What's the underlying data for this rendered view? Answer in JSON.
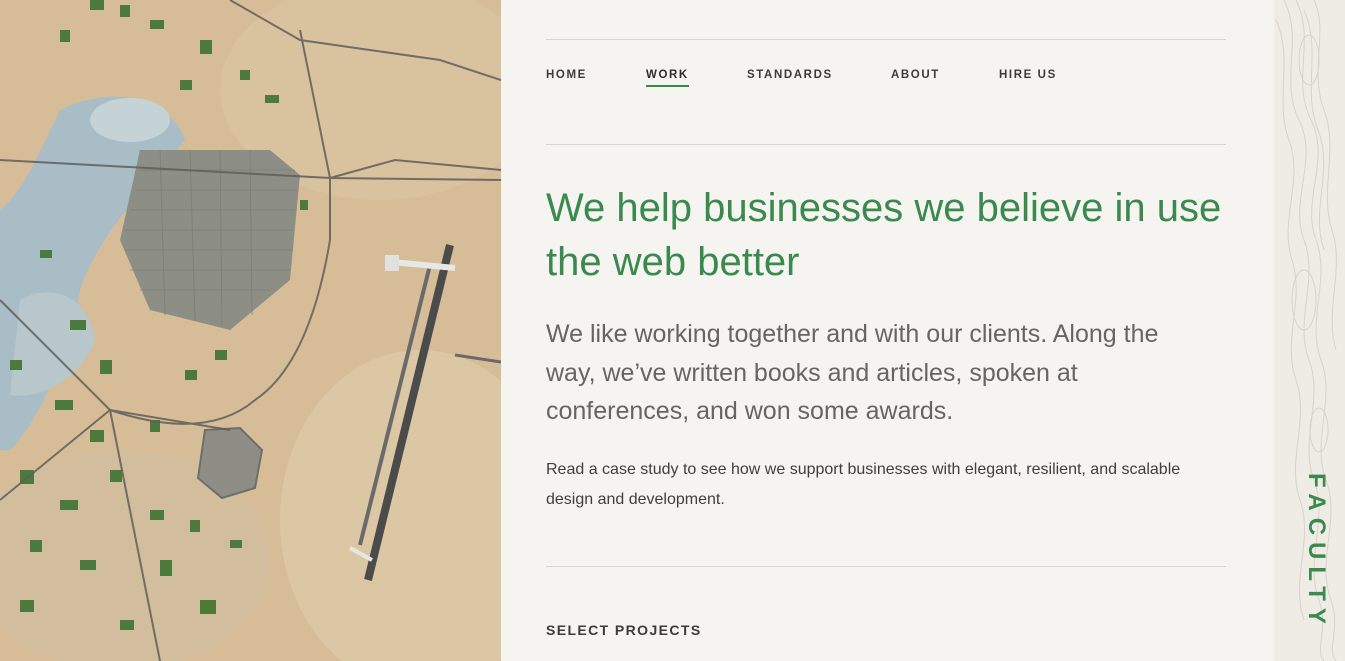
{
  "brand": {
    "name": "FACULTY"
  },
  "nav": {
    "items": [
      {
        "label": "HOME"
      },
      {
        "label": "WORK"
      },
      {
        "label": "STANDARDS"
      },
      {
        "label": "ABOUT"
      },
      {
        "label": "HIRE US"
      }
    ],
    "active": "WORK"
  },
  "hero": {
    "headline": "We help businesses we believe in use the web better",
    "intro": "We like working together and with our clients. Along the way, we’ve written books and articles, spoken at conferences, and won some awards.",
    "case_study": "Read a case study to see how we support businesses with elegant, resilient, and scalable design and development."
  },
  "projects": {
    "section_title": "SELECT PROJECTS"
  },
  "colors": {
    "accent": "#3a8a4e",
    "background": "#f5f4f1",
    "body_text": "#3f3f3f",
    "muted_text": "#666563"
  }
}
